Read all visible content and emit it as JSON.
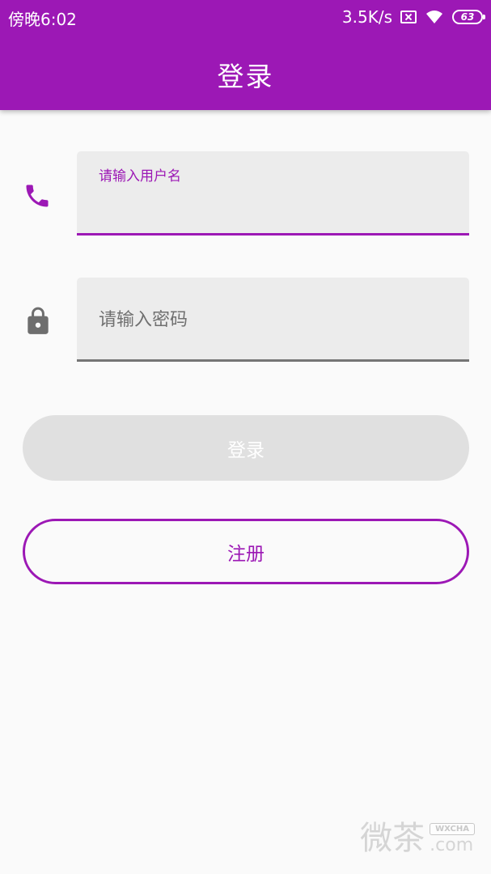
{
  "status_bar": {
    "time": "傍晚6:02",
    "network_speed": "3.5K/s",
    "battery_level": "63",
    "icons": [
      "sim-icon",
      "wifi-icon",
      "battery-icon"
    ]
  },
  "app_bar": {
    "title": "登录"
  },
  "username_field": {
    "label": "请输入用户名",
    "value": "",
    "state": "focused",
    "icon": "phone-icon"
  },
  "password_field": {
    "placeholder": "请输入密码",
    "value": "",
    "icon": "lock-icon"
  },
  "buttons": {
    "login_label": "登录",
    "login_enabled": false,
    "register_label": "注册"
  },
  "watermark": {
    "main": "微茶",
    "badge": "WXCHA",
    "domain": ".com"
  },
  "colors": {
    "primary": "#9c18b5",
    "background": "#fafafa",
    "field_fill": "#ececec",
    "disabled_button": "#e0e0e0",
    "icon_gray": "#6e6e6e"
  }
}
